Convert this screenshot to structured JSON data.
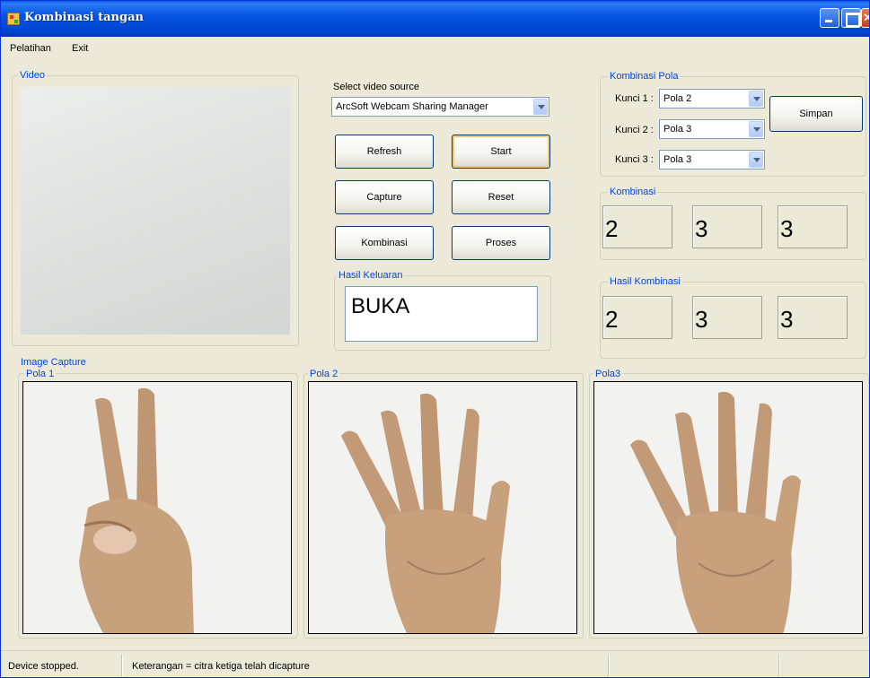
{
  "window": {
    "title": "Kombinasi tangan"
  },
  "menu": {
    "items": [
      "Pelatihan",
      "Exit"
    ]
  },
  "video_group": {
    "label": "Video"
  },
  "source": {
    "label": "Select video source",
    "value": "ArcSoft Webcam Sharing Manager"
  },
  "buttons": {
    "refresh": "Refresh",
    "start": "Start",
    "capture": "Capture",
    "reset": "Reset",
    "kombinasi": "Kombinasi",
    "proses": "Proses",
    "simpan": "Simpan"
  },
  "hasil_keluaran": {
    "label": "Hasil Keluaran",
    "value": "BUKA"
  },
  "kombinasi_pola": {
    "label": "Kombinasi Pola",
    "keys": [
      {
        "label": "Kunci 1 :",
        "value": "Pola 2"
      },
      {
        "label": "Kunci 2 :",
        "value": "Pola 3"
      },
      {
        "label": "Kunci 3 :",
        "value": "Pola 3"
      }
    ]
  },
  "kombinasi": {
    "label": "Kombinasi",
    "values": [
      "2",
      "3",
      "3"
    ]
  },
  "hasil_kombinasi": {
    "label": "Hasil Kombinasi",
    "values": [
      "2",
      "3",
      "3"
    ]
  },
  "image_capture": {
    "label": "Image Capture",
    "panels": [
      {
        "label": "Pola 1",
        "gesture": "two-fingers-hand-icon"
      },
      {
        "label": "Pola 2",
        "gesture": "open-palm-hand-icon"
      },
      {
        "label": "Pola3",
        "gesture": "open-palm-hand-icon"
      }
    ]
  },
  "status": {
    "device": "Device stopped.",
    "keterangan": "Keterangan =  citra ketiga telah dicapture"
  },
  "colors": {
    "title_bar": "#0054e3",
    "group_label": "#0046d5",
    "window_bg": "#ece9d8",
    "skin": "#c8a07c"
  }
}
